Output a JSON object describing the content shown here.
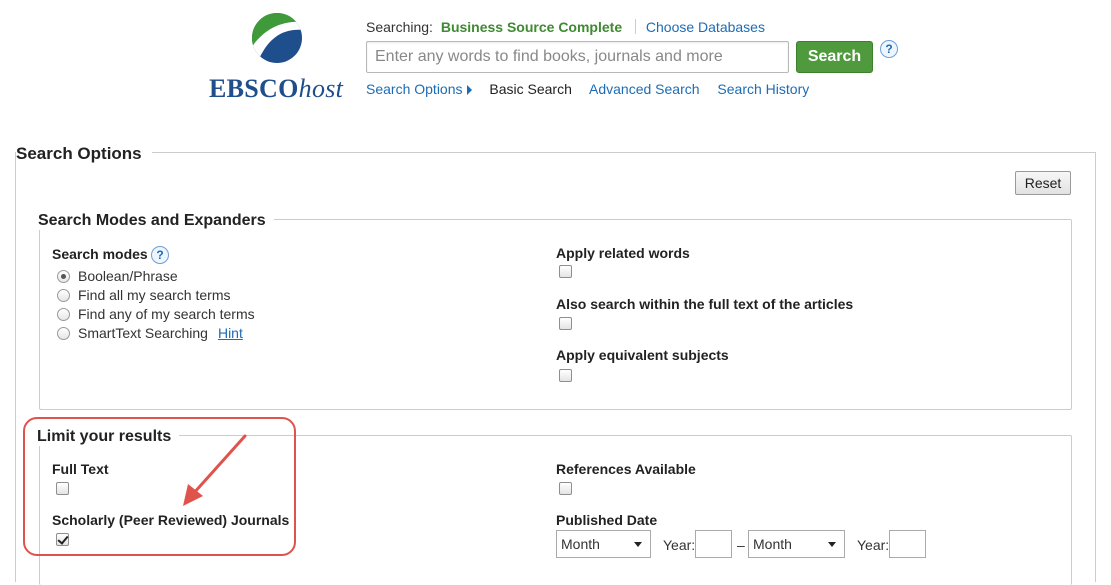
{
  "header": {
    "logo": {
      "brand": "EBSCO",
      "suffix": "host",
      "icon": "ebsco-globe-icon"
    },
    "searching_label": "Searching:",
    "database_name": "Business Source Complete",
    "choose_databases": "Choose Databases",
    "search_placeholder": "Enter any words to find books, journals and more",
    "search_button": "Search",
    "help_icon": "?",
    "nav": {
      "search_options": "Search Options",
      "basic_search": "Basic Search",
      "advanced_search": "Advanced Search",
      "search_history": "Search History"
    }
  },
  "search_options": {
    "title": "Search Options",
    "reset_button": "Reset",
    "modes_section": {
      "title": "Search Modes and Expanders",
      "search_modes_label": "Search modes",
      "help_icon": "?",
      "modes": [
        {
          "label": "Boolean/Phrase",
          "selected": true
        },
        {
          "label": "Find all my search terms",
          "selected": false
        },
        {
          "label": "Find any of my search terms",
          "selected": false
        },
        {
          "label": "SmartText Searching",
          "selected": false
        }
      ],
      "hint_link": "Hint",
      "expanders": [
        {
          "label": "Apply related words",
          "checked": false
        },
        {
          "label": "Also search within the full text of the articles",
          "checked": false
        },
        {
          "label": "Apply equivalent subjects",
          "checked": false
        }
      ]
    },
    "limit_section": {
      "title": "Limit your results",
      "full_text": {
        "label": "Full Text",
        "checked": false
      },
      "scholarly": {
        "label": "Scholarly (Peer Reviewed) Journals",
        "checked": true
      },
      "references": {
        "label": "References Available",
        "checked": false
      },
      "published_date": {
        "label": "Published Date",
        "from_month": "Month",
        "from_year_label": "Year:",
        "dash": "–",
        "to_month": "Month",
        "to_year_label": "Year:"
      }
    }
  },
  "colors": {
    "link": "#1c6cb5",
    "search_button": "#4f9a3c",
    "database_name": "#3f8a32",
    "annotation": "#e0534c",
    "logo_blue": "#1f4e8c"
  }
}
